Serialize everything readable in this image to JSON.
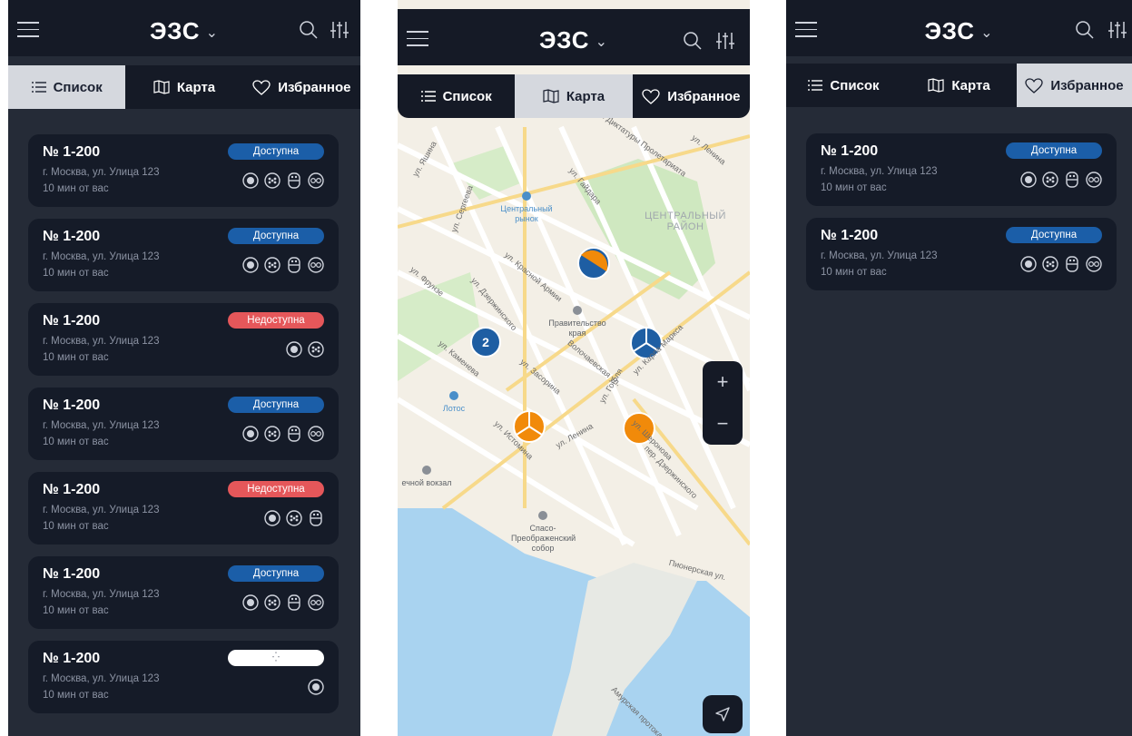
{
  "app": {
    "brand": "ЭЗС",
    "brand_chevron": "⌄"
  },
  "tabs": {
    "list": "Список",
    "map": "Карта",
    "favorites": "Избранное"
  },
  "list_cards": [
    {
      "number": "№ 1-200",
      "address": "г. Москва, ул. Улица 123",
      "distance": "10 мин от вас",
      "status": "Доступна",
      "state": "ok",
      "plugs": 4
    },
    {
      "number": "№ 1-200",
      "address": "г. Москва, ул. Улица 123",
      "distance": "10 мин от вас",
      "status": "Доступна",
      "state": "ok",
      "plugs": 4
    },
    {
      "number": "№ 1-200",
      "address": "г. Москва, ул. Улица 123",
      "distance": "10 мин от вас",
      "status": "Недоступна",
      "state": "bad",
      "plugs": 2
    },
    {
      "number": "№ 1-200",
      "address": "г. Москва, ул. Улица 123",
      "distance": "10 мин от вас",
      "status": "Доступна",
      "state": "ok",
      "plugs": 4
    },
    {
      "number": "№ 1-200",
      "address": "г. Москва, ул. Улица 123",
      "distance": "10 мин от вас",
      "status": "Недоступна",
      "state": "bad",
      "plugs": 3
    },
    {
      "number": "№ 1-200",
      "address": "г. Москва, ул. Улица 123",
      "distance": "10 мин от вас",
      "status": "Доступна",
      "state": "ok",
      "plugs": 4
    },
    {
      "number": "№ 1-200",
      "address": "г. Москва, ул. Улица 123",
      "distance": "10 мин от вас",
      "status": "⁛",
      "state": "load",
      "plugs": 1
    }
  ],
  "favorite_cards": [
    {
      "number": "№ 1-200",
      "address": "г. Москва, ул. Улица 123",
      "distance": "10 мин от вас",
      "status": "Доступна",
      "state": "ok",
      "plugs": 4
    },
    {
      "number": "№ 1-200",
      "address": "г. Москва, ул. Улица 123",
      "distance": "10 мин от вас",
      "status": "Доступна",
      "state": "ok",
      "plugs": 4
    }
  ],
  "map": {
    "cluster_count": "2",
    "zoom_in": "+",
    "zoom_out": "−",
    "streets": [
      "ул. Яшина",
      "ул. Диктатуры Пролетариата",
      "ул. Ленина",
      "ул. Сергеева",
      "ул. Гайдара",
      "ул. Дзержинского",
      "ул. Фрунзе",
      "ул. Красной Армии",
      "ул. Карла Маркса",
      "ул. Каменева",
      "ул. Засорина",
      "ул. Гоголя",
      "Волочаевская ул.",
      "ул. Истомина",
      "ул. Ленина",
      "ул. Шеронова",
      "пер. Дзержинского",
      "Пионерская ул.",
      "Амурская протока"
    ],
    "districts": [
      "ЦЕНТРАЛЬНЫЙ РАЙОН"
    ],
    "pois": [
      "Центральный рынок",
      "Правительство края",
      "Лотос",
      "ечной вокзал",
      "Спасо-Преображенский собор"
    ],
    "colors": {
      "blue": "#1e5ea3",
      "orange": "#f18a0a"
    }
  },
  "colors": {
    "bg_dark": "#252b37",
    "header": "#151a26",
    "card": "#151b28",
    "ok": "#1b5ea8",
    "bad": "#e5575a"
  }
}
